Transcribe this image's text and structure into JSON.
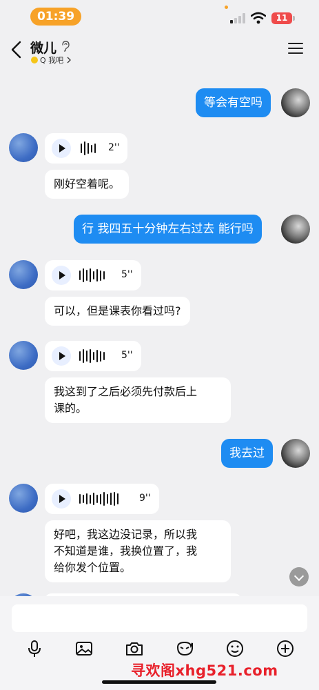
{
  "status_bar": {
    "time": "01:39",
    "battery": "11"
  },
  "header": {
    "contact_name": "微儿",
    "sub_label": "Q 我吧"
  },
  "messages": [
    {
      "from": "me",
      "type": "text",
      "text": "等会有空吗"
    },
    {
      "from": "them",
      "type": "voice",
      "duration": "2''"
    },
    {
      "from": "them",
      "type": "text",
      "text": "刚好空着呢。"
    },
    {
      "from": "me",
      "type": "text",
      "text": "行 我四五十分钟左右过去 能行吗"
    },
    {
      "from": "them",
      "type": "voice",
      "duration": "5''"
    },
    {
      "from": "them",
      "type": "text",
      "text": "可以，但是课表你看过吗?"
    },
    {
      "from": "them",
      "type": "voice",
      "duration": "5''"
    },
    {
      "from": "them",
      "type": "text",
      "lines": [
        "我这到了之后必须先付款后上",
        "课的。"
      ]
    },
    {
      "from": "me",
      "type": "text",
      "text": "我去过"
    },
    {
      "from": "them",
      "type": "voice",
      "duration": "9''"
    },
    {
      "from": "them",
      "type": "text",
      "lines": [
        "好吧，我这边没记录，所以我",
        "不知道是谁，我换位置了，我",
        "给你发个位置。"
      ]
    }
  ],
  "input": {
    "placeholder": ""
  },
  "toolbar": [
    "mic-icon",
    "image-icon",
    "camera-icon",
    "sticker-icon",
    "emoji-icon",
    "plus-icon"
  ],
  "watermark": "寻欢阁xhg521.com",
  "colors": {
    "my_bubble": "#1e8cf2",
    "status_pill": "#f7a228",
    "battery": "#ef4b4b",
    "watermark": "#e8202a"
  }
}
